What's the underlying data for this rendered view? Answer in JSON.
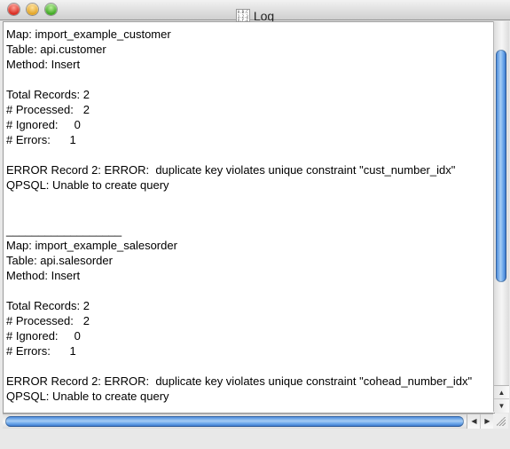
{
  "window": {
    "title": "Log",
    "icon_name": "log-document-icon",
    "icon_glyph": "A.B.C\n1.2.3\nX.Y.Z"
  },
  "log": {
    "text": "Map: import_example_customer\nTable: api.customer\nMethod: Insert\n\nTotal Records: 2\n# Processed:   2\n# Ignored:     0\n# Errors:      1\n\nERROR Record 2: ERROR:  duplicate key violates unique constraint \"cust_number_idx\"\nQPSQL: Unable to create query\n\n\n__________________\nMap: import_example_salesorder\nTable: api.salesorder\nMethod: Insert\n\nTotal Records: 2\n# Processed:   2\n# Ignored:     0\n# Errors:      1\n\nERROR Record 2: ERROR:  duplicate key violates unique constraint \"cohead_number_idx\"\nQPSQL: Unable to create query"
  },
  "scrollbars": {
    "up_arrow": "▲",
    "down_arrow": "▼",
    "left_arrow": "◀",
    "right_arrow": "▶"
  },
  "colors": {
    "scroll_thumb": "#5b9be6",
    "close": "#d6261b",
    "minimize": "#e0a222",
    "zoom": "#3aa51e"
  }
}
